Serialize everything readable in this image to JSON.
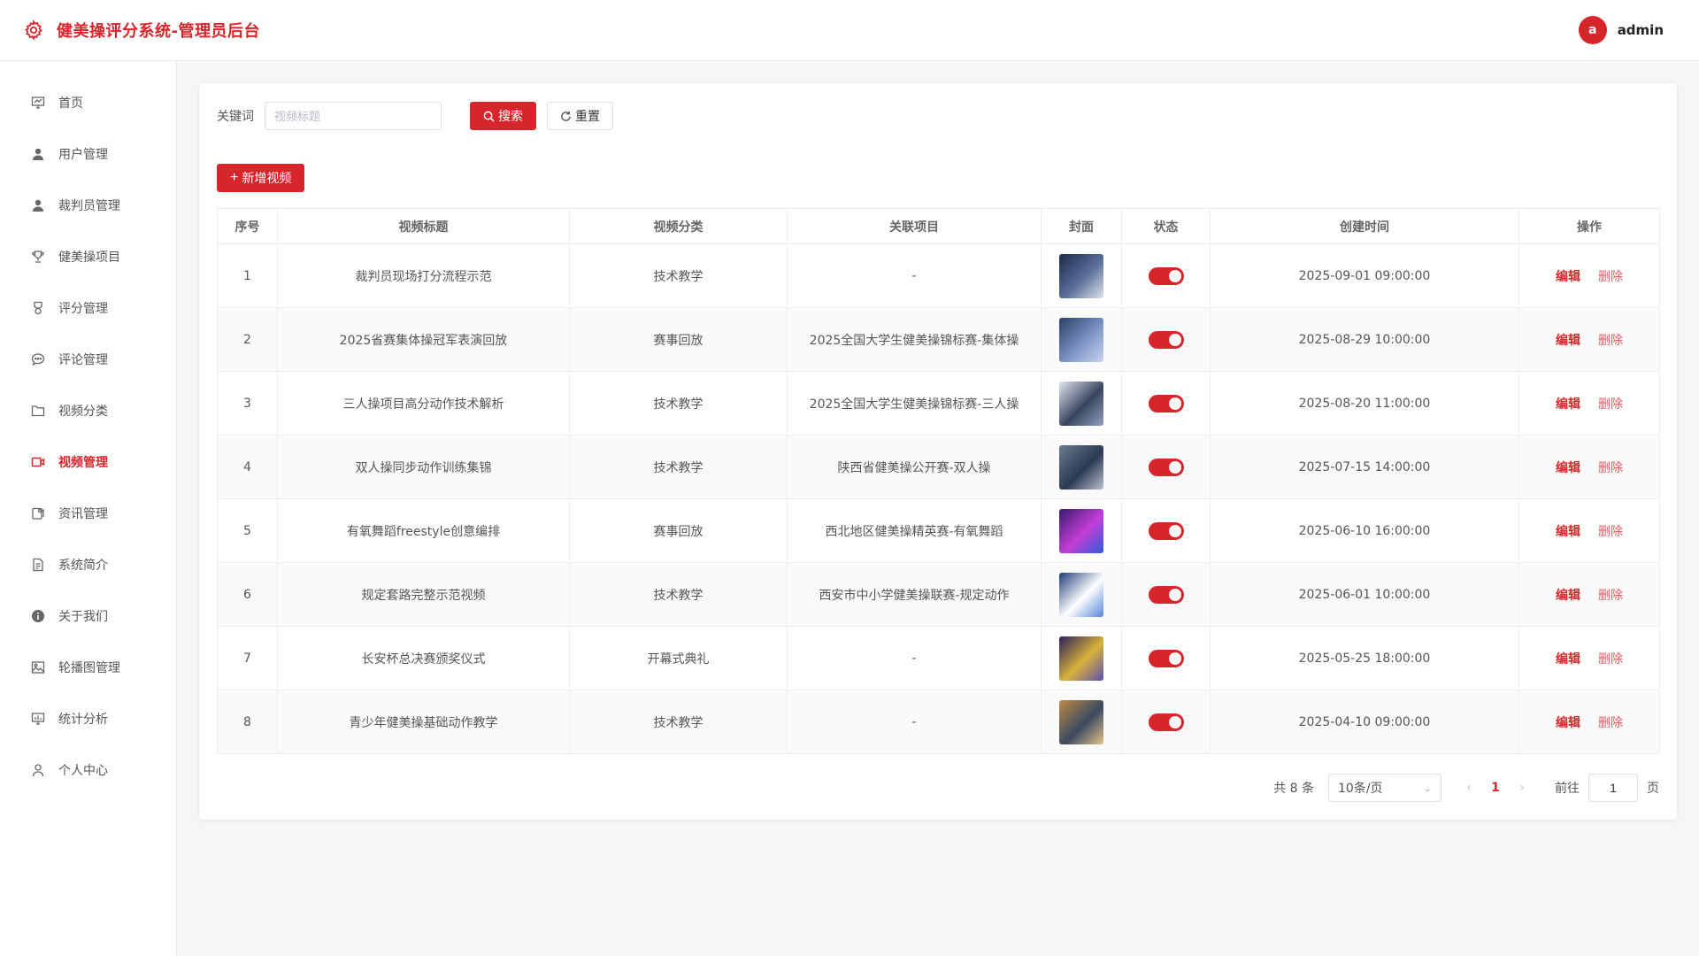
{
  "header": {
    "title": "健美操评分系统-管理员后台",
    "avatar_letter": "a",
    "username": "admin"
  },
  "sidebar": {
    "items": [
      {
        "label": "首页",
        "icon": "dashboard-icon"
      },
      {
        "label": "用户管理",
        "icon": "user-icon"
      },
      {
        "label": "裁判员管理",
        "icon": "user-icon"
      },
      {
        "label": "健美操项目",
        "icon": "trophy-icon"
      },
      {
        "label": "评分管理",
        "icon": "medal-icon"
      },
      {
        "label": "评论管理",
        "icon": "comment-icon"
      },
      {
        "label": "视频分类",
        "icon": "folder-icon"
      },
      {
        "label": "视频管理",
        "icon": "video-icon"
      },
      {
        "label": "资讯管理",
        "icon": "news-icon"
      },
      {
        "label": "系统简介",
        "icon": "document-icon"
      },
      {
        "label": "关于我们",
        "icon": "info-icon"
      },
      {
        "label": "轮播图管理",
        "icon": "image-icon"
      },
      {
        "label": "统计分析",
        "icon": "chart-icon"
      },
      {
        "label": "个人中心",
        "icon": "person-icon"
      }
    ],
    "active_index": 7
  },
  "search": {
    "label": "关键词",
    "placeholder": "视频标题",
    "search_label": "搜索",
    "reset_label": "重置"
  },
  "add_button": {
    "label": "新增视频"
  },
  "table": {
    "columns": [
      "序号",
      "视频标题",
      "视频分类",
      "关联项目",
      "封面",
      "状态",
      "创建时间",
      "操作"
    ],
    "edit_label": "编辑",
    "delete_label": "删除",
    "rows": [
      {
        "index": "1",
        "title": "裁判员现场打分流程示范",
        "category": "技术教学",
        "project": "-",
        "status": true,
        "created": "2025-09-01 09:00:00"
      },
      {
        "index": "2",
        "title": "2025省赛集体操冠军表演回放",
        "category": "赛事回放",
        "project": "2025全国大学生健美操锦标赛-集体操",
        "status": true,
        "created": "2025-08-29 10:00:00"
      },
      {
        "index": "3",
        "title": "三人操项目高分动作技术解析",
        "category": "技术教学",
        "project": "2025全国大学生健美操锦标赛-三人操",
        "status": true,
        "created": "2025-08-20 11:00:00"
      },
      {
        "index": "4",
        "title": "双人操同步动作训练集锦",
        "category": "技术教学",
        "project": "陕西省健美操公开赛-双人操",
        "status": true,
        "created": "2025-07-15 14:00:00"
      },
      {
        "index": "5",
        "title": "有氧舞蹈freestyle创意编排",
        "category": "赛事回放",
        "project": "西北地区健美操精英赛-有氧舞蹈",
        "status": true,
        "created": "2025-06-10 16:00:00"
      },
      {
        "index": "6",
        "title": "规定套路完整示范视频",
        "category": "技术教学",
        "project": "西安市中小学健美操联赛-规定动作",
        "status": true,
        "created": "2025-06-01 10:00:00"
      },
      {
        "index": "7",
        "title": "长安杯总决赛颁奖仪式",
        "category": "开幕式典礼",
        "project": "-",
        "status": true,
        "created": "2025-05-25 18:00:00"
      },
      {
        "index": "8",
        "title": "青少年健美操基础动作教学",
        "category": "技术教学",
        "project": "-",
        "status": true,
        "created": "2025-04-10 09:00:00"
      }
    ]
  },
  "pagination": {
    "total_text": "共 8 条",
    "page_size": "10条/页",
    "current_page": "1",
    "goto_label": "前往",
    "goto_value": "1",
    "page_suffix": "页"
  },
  "colors": {
    "accent": "#d7262b"
  }
}
